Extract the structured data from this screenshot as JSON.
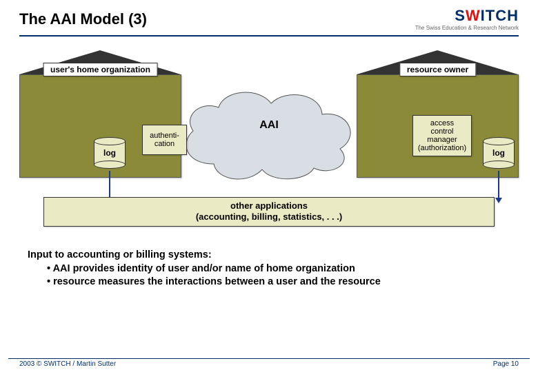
{
  "title": "The AAI Model (3)",
  "logo": {
    "text": "SWITCH",
    "tagline": "The Swiss Education & Research Network"
  },
  "diagram": {
    "left_house_label": "user's home organization",
    "right_house_label": "resource owner",
    "cloud_label": "AAI",
    "auth_box_line1": "authenti-",
    "auth_box_line2": "cation",
    "acm_line1": "access",
    "acm_line2": "control",
    "acm_line3": "manager",
    "acm_line4": "(authorization)",
    "log_left": "log",
    "log_right": "log",
    "other_apps_line1": "other applications",
    "other_apps_line2": "(accounting, billing, statistics, . . .)"
  },
  "body": {
    "heading": "Input to accounting or billing systems:",
    "bullet1": "• AAI provides identity of user and/or name of home organization",
    "bullet2": "• resource measures the interactions between a user and the resource"
  },
  "footer": {
    "left": "2003 © SWITCH / Martin Sutter",
    "right": "Page 10"
  }
}
